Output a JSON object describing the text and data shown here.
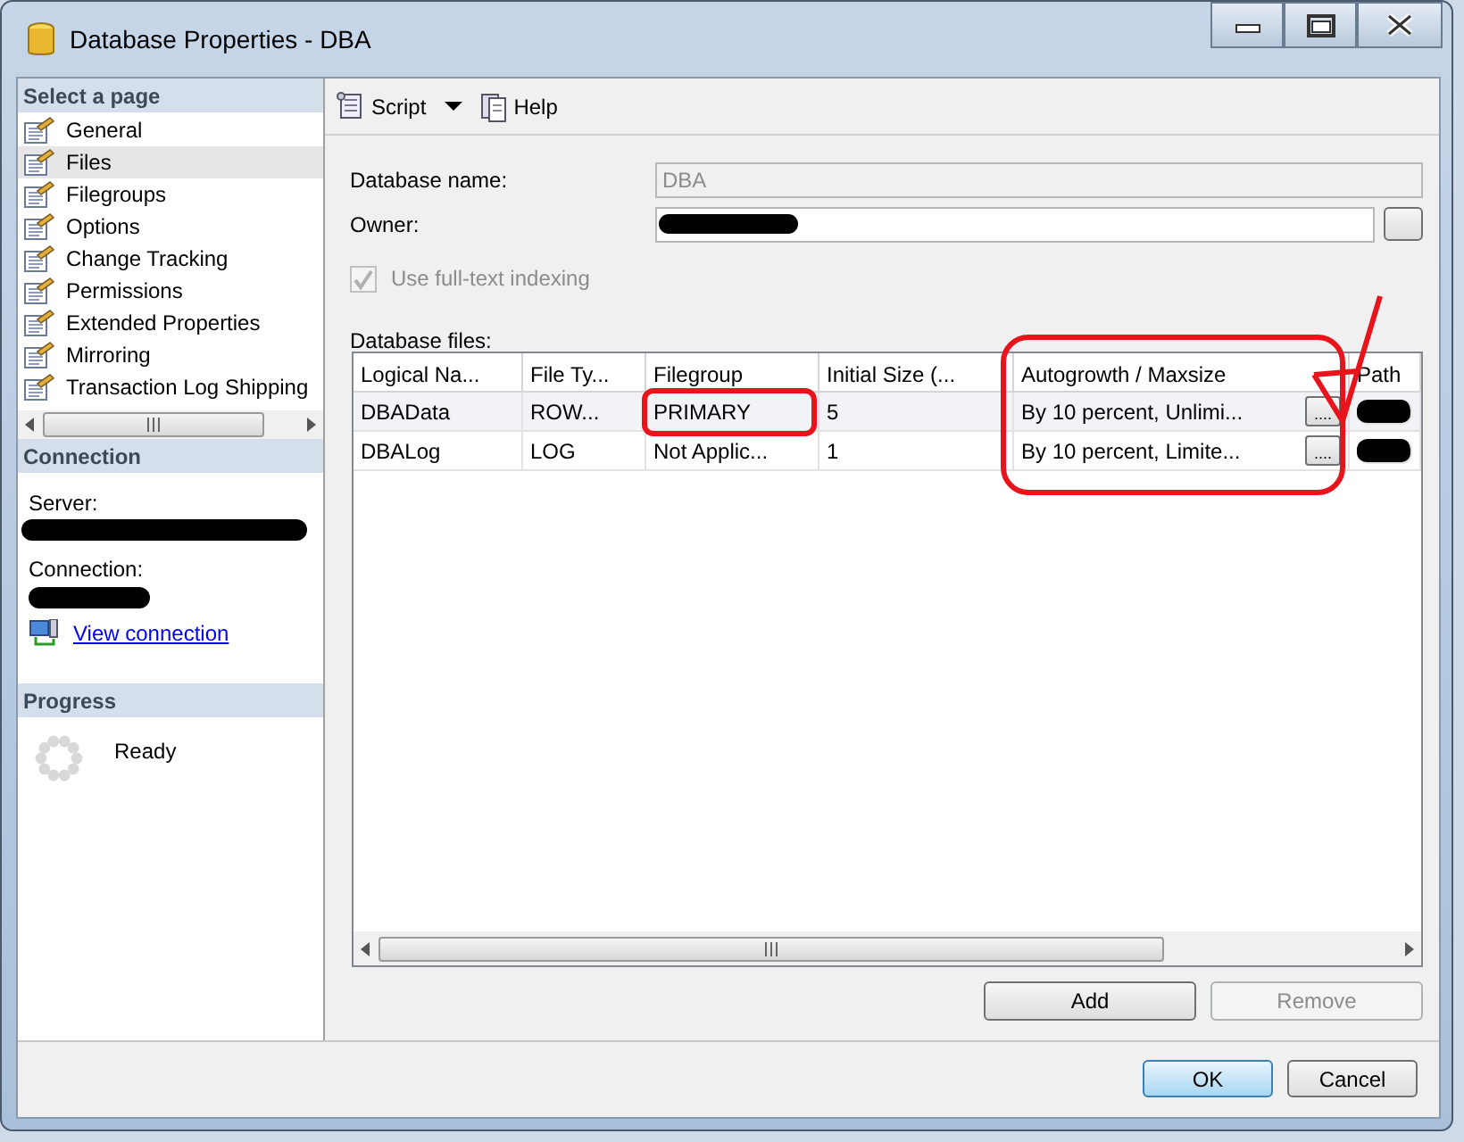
{
  "window": {
    "title": "Database Properties - DBA"
  },
  "sidebar": {
    "header": "Select a page",
    "items": [
      {
        "label": "General",
        "selected": false
      },
      {
        "label": "Files",
        "selected": true
      },
      {
        "label": "Filegroups",
        "selected": false
      },
      {
        "label": "Options",
        "selected": false
      },
      {
        "label": "Change Tracking",
        "selected": false
      },
      {
        "label": "Permissions",
        "selected": false
      },
      {
        "label": "Extended Properties",
        "selected": false
      },
      {
        "label": "Mirroring",
        "selected": false
      },
      {
        "label": "Transaction Log Shipping",
        "selected": false
      }
    ]
  },
  "connection": {
    "header": "Connection",
    "server_label": "Server:",
    "connection_label": "Connection:",
    "link": "View connection"
  },
  "progress": {
    "header": "Progress",
    "status": "Ready"
  },
  "toolbar": {
    "script": "Script",
    "help": "Help"
  },
  "form": {
    "name_label": "Database name:",
    "name_value": "DBA",
    "owner_label": "Owner:",
    "fulltext": {
      "label": "Use full-text indexing",
      "checked": true,
      "disabled": true
    }
  },
  "files": {
    "label": "Database files:",
    "columns": [
      "Logical Na...",
      "File Ty...",
      "Filegroup",
      "Initial Size (...",
      "Autogrowth / Maxsize",
      "Path"
    ],
    "rows": [
      {
        "cells": [
          "DBAData",
          "ROW...",
          "PRIMARY",
          "5",
          "By 10 percent, Unlimi..."
        ],
        "button": "....",
        "selected": true
      },
      {
        "cells": [
          "DBALog",
          "LOG",
          "Not Applic...",
          "1",
          "By 10 percent, Limite..."
        ],
        "button": "....",
        "selected": false
      }
    ]
  },
  "grid_buttons": [
    {
      "label": "Add",
      "disabled": false
    },
    {
      "label": "Remove",
      "disabled": true
    }
  ],
  "footer_buttons": [
    {
      "label": "OK",
      "default": true
    },
    {
      "label": "Cancel",
      "default": false
    }
  ]
}
